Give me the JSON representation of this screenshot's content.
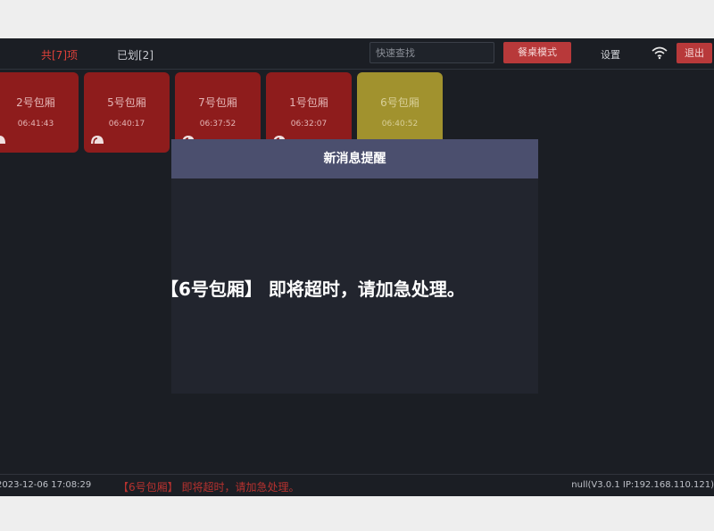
{
  "topbar": {
    "tab_all": "共[7]项",
    "tab_done": "已划[2]",
    "search_placeholder": "快速查找",
    "mode_button": "餐桌模式",
    "settings": "设置",
    "exit_button": "退出",
    "icons": [
      "wifi-icon"
    ]
  },
  "cards": [
    {
      "name": "2号包厢",
      "time": "06:41:43",
      "status": "red"
    },
    {
      "name": "5号包厢",
      "time": "06:40:17",
      "status": "red"
    },
    {
      "name": "7号包厢",
      "time": "06:37:52",
      "status": "red"
    },
    {
      "name": "1号包厢",
      "time": "06:32:07",
      "status": "red"
    },
    {
      "name": "6号包厢",
      "time": "06:40:52",
      "status": "yellow"
    }
  ],
  "modal": {
    "title": "新消息提醒",
    "message": "【6号包厢】 即将超时，请加急处理。"
  },
  "statusbar": {
    "datetime": "2023-12-06 17:08:29",
    "message": "【6号包厢】 即将超时，请加急处理。",
    "version": "null(V3.0.1 IP:192.168.110.121)"
  },
  "colors": {
    "background": "#1b1e24",
    "accent_red": "#b8393a",
    "card_red": "#8e1c1c",
    "card_yellow": "#a1922e",
    "modal_header": "#4b4f6e"
  }
}
